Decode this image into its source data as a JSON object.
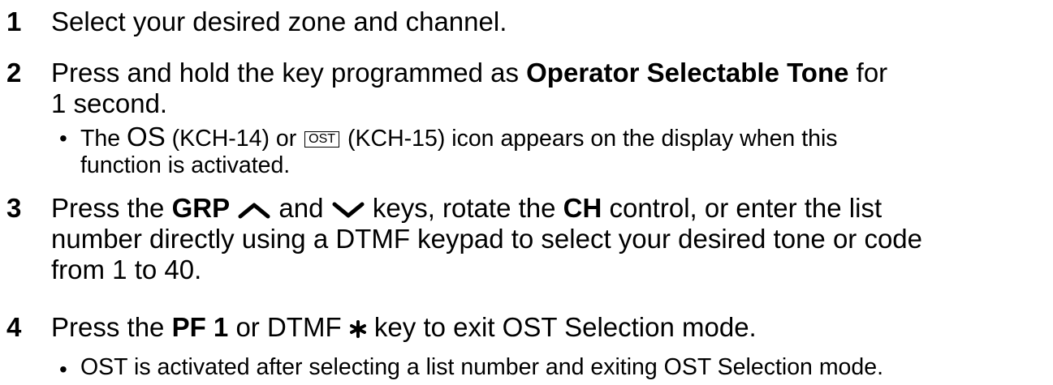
{
  "steps": [
    {
      "number": "1",
      "text": "Select your desired zone and channel."
    },
    {
      "number": "2",
      "text_a": "Press and hold the key programmed as ",
      "bold_a": "Operator Selectable Tone",
      "text_b": " for",
      "line2": "1 second.",
      "bullet": {
        "t1": "The ",
        "os_icon": "OS",
        "t2": " (KCH-14) or ",
        "ost_icon": "OST",
        "t3": " (KCH-15) icon appears on the display when this",
        "line2": "function is activated."
      }
    },
    {
      "number": "3",
      "t1": "Press the ",
      "grp": "GRP",
      "up_icon": "chevron-up-icon",
      "t2": " and ",
      "down_icon": "chevron-down-icon",
      "t3": " keys, rotate the ",
      "ch": "CH",
      "t4": " control, or enter the list",
      "line2": "number directly using a DTMF keypad to select your desired tone or code",
      "line3": "from 1 to 40."
    },
    {
      "number": "4",
      "t1": "Press the ",
      "pf": "PF 1",
      "t2": " or DTMF ",
      "star_icon": "asterisk-icon",
      "t3": " key to exit OST Selection mode.",
      "bullet": {
        "text": "OST is activated after selecting a list number and exiting OST Selection mode."
      }
    }
  ],
  "bullet_char": "•"
}
